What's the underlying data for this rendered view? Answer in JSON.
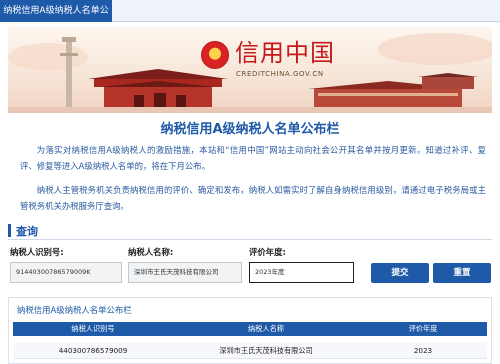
{
  "tab": {
    "label": "纳税信用A级纳税人名单公布栏"
  },
  "banner": {
    "brand_cn": "信用中国",
    "brand_en": "CREDITCHINA.GOV.CN"
  },
  "page_title": "纳税信用A级纳税人名单公布栏",
  "intro": {
    "p1": "为落实对纳税信用A级纳税人的激励措施，本站和“信用中国”网站主动向社会公开其名单并按月更新。知道过补评、复评、修复等进入A级纳税人名单的，将在下月公布。",
    "p2": "纳税人主管税务机关负责纳税信用的评价、确定和发布，纳税人如需实时了解自身纳税信用级别，请通过电子税务局或主管税务机关办税服务厅查询。"
  },
  "query": {
    "section_title": "查询",
    "taxpayer_id_label": "纳税人识别号:",
    "taxpayer_id_value": "91440300786579009K",
    "taxpayer_name_label": "纳税人名称:",
    "taxpayer_name_value": "深圳市王氏天茂科技有限公司",
    "year_label": "评价年度:",
    "year_value": "2023年度",
    "submit_label": "提交",
    "reset_label": "重置"
  },
  "results": {
    "title": "纳税信用A级纳税人名单公布栏",
    "columns": [
      "纳税人识别号",
      "纳税人名称",
      "评价年度"
    ],
    "rows": [
      [
        "440300786579009",
        "深圳市王氏天茂科技有限公司",
        "2023"
      ]
    ]
  },
  "colors": {
    "primary": "#1e5aa8",
    "brand_red": "#c41a1a"
  }
}
